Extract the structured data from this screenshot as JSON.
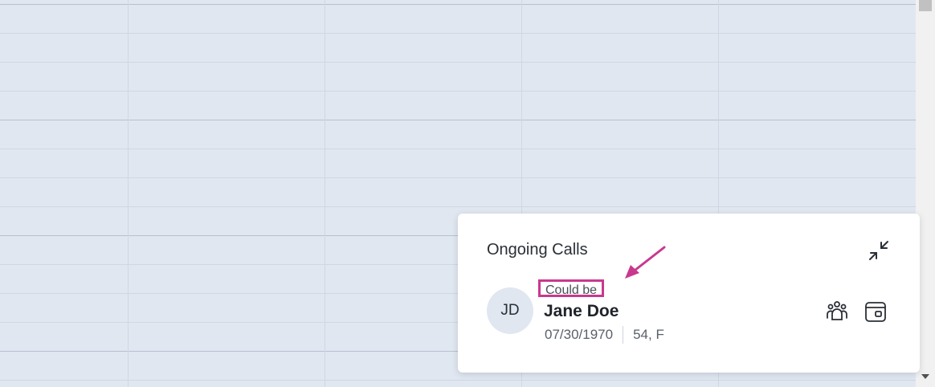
{
  "panel": {
    "title": "Ongoing Calls"
  },
  "call": {
    "initials": "JD",
    "match_label": "Could be",
    "name": "Jane Doe",
    "dob": "07/30/1970",
    "age_sex": "54, F"
  },
  "icons": {
    "minimize": "minimize-icon",
    "team": "team-icon",
    "wallet": "wallet-icon"
  },
  "colors": {
    "highlight": "#c8398e",
    "background_grid": "#e1e7f0"
  }
}
